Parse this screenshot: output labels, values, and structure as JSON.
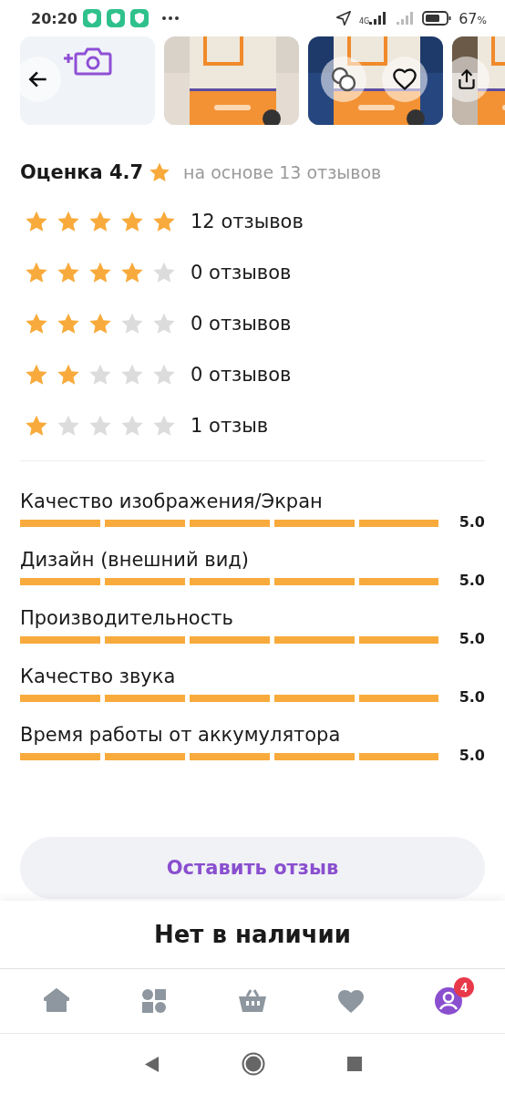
{
  "status_bar": {
    "time": "20:20",
    "network": "4G",
    "battery": "67",
    "battery_unit": "%"
  },
  "gallery": {
    "favorite": false
  },
  "rating": {
    "title": "Оценка 4.7",
    "subtitle": "на основе 13 отзывов",
    "breakdown": [
      {
        "stars": 5,
        "label": "12 отзывов"
      },
      {
        "stars": 4,
        "label": "0 отзывов"
      },
      {
        "stars": 3,
        "label": "0 отзывов"
      },
      {
        "stars": 2,
        "label": "0 отзывов"
      },
      {
        "stars": 1,
        "label": "1 отзыв"
      }
    ]
  },
  "criteria": [
    {
      "label": "Качество изображения/Экран",
      "level": 1,
      "value": "5.0"
    },
    {
      "label": "Дизайн (внешний вид)",
      "level": 1,
      "value": "5.0"
    },
    {
      "label": "Производительность",
      "level": 1,
      "value": "5.0"
    },
    {
      "label": "Качество звука",
      "level": 1,
      "value": "5.0"
    },
    {
      "label": "Время работы от аккумулятора",
      "level": 1,
      "value": "5.0"
    }
  ],
  "review_button": "Оставить отзыв",
  "availability": "Нет в наличии",
  "bottom_nav": [
    {
      "kind": "home",
      "selected": false
    },
    {
      "kind": "catalog",
      "selected": false
    },
    {
      "kind": "cart",
      "selected": false
    },
    {
      "kind": "favorites",
      "selected": false
    },
    {
      "kind": "profile",
      "selected": true,
      "badge": "4"
    }
  ]
}
